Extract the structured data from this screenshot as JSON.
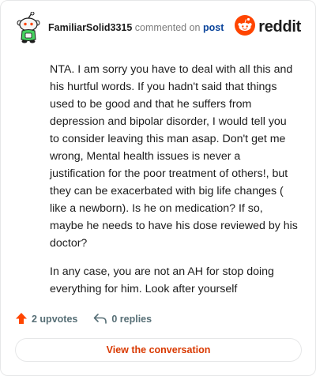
{
  "comment": {
    "username": "FamiliarSolid3315",
    "action_text": "commented on",
    "post_link": "post",
    "paragraphs": [
      "NTA. I am sorry you have to deal with all this and his hurtful words. If you hadn't said that things used to be good and that he suffers from depression and bipolar disorder, I would tell you to consider leaving this man asap. Don't get me wrong, Mental health issues is never a justification for the poor treatment of others!, but they can be exacerbated with big life changes ( like a newborn). Is he on medication? If so, maybe he needs to have his dose reviewed by his doctor?",
      "In any case, you are not an AH for stop doing everything for him. Look after yourself"
    ],
    "upvotes": "2 upvotes",
    "replies": "0 replies"
  },
  "brand": {
    "name": "reddit",
    "color": "#ff4500"
  },
  "cta": {
    "label": "View the conversation"
  },
  "icons": {
    "avatar": "snoo-avatar",
    "logo": "reddit-alien-icon",
    "upvote": "upvote-arrow-icon",
    "reply": "reply-arrow-icon"
  },
  "colors": {
    "upvote": "#ff4500",
    "link": "#0a449b",
    "cta_text": "#d93900",
    "meta": "#576f76"
  }
}
